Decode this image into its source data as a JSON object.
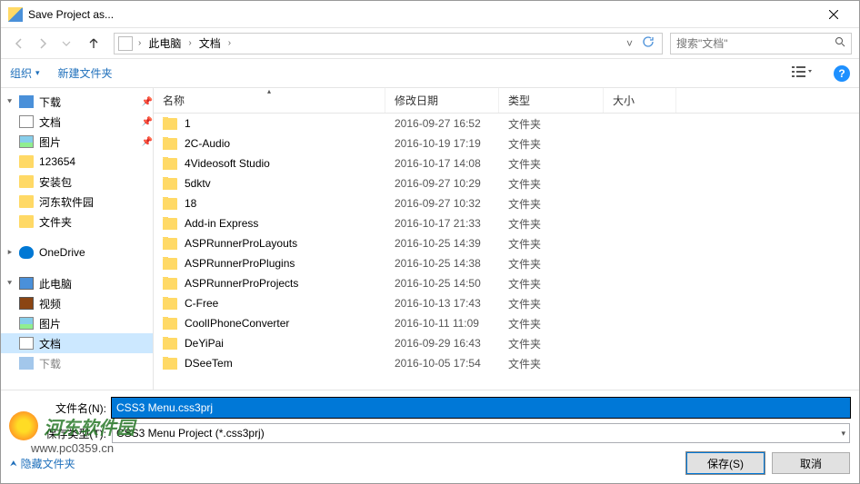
{
  "title": "Save Project as...",
  "breadcrumb": {
    "pc": "此电脑",
    "docs": "文档"
  },
  "search_placeholder": "搜索\"文档\"",
  "toolbar": {
    "organize": "组织",
    "newfolder": "新建文件夹"
  },
  "sidebar": {
    "downloads": "下载",
    "docs": "文档",
    "pics": "图片",
    "f123654": "123654",
    "install": "安装包",
    "hedong": "河东软件园",
    "folder": "文件夹",
    "onedrive": "OneDrive",
    "thispc": "此电脑",
    "video": "视频",
    "pics2": "图片",
    "docs2": "文档",
    "downloads2": "下载"
  },
  "columns": {
    "name": "名称",
    "date": "修改日期",
    "type": "类型",
    "size": "大小"
  },
  "files": [
    {
      "name": "1",
      "date": "2016-09-27 16:52",
      "type": "文件夹"
    },
    {
      "name": "2C-Audio",
      "date": "2016-10-19 17:19",
      "type": "文件夹"
    },
    {
      "name": "4Videosoft Studio",
      "date": "2016-10-17 14:08",
      "type": "文件夹"
    },
    {
      "name": "5dktv",
      "date": "2016-09-27 10:29",
      "type": "文件夹"
    },
    {
      "name": "18",
      "date": "2016-09-27 10:32",
      "type": "文件夹"
    },
    {
      "name": "Add-in Express",
      "date": "2016-10-17 21:33",
      "type": "文件夹"
    },
    {
      "name": "ASPRunnerProLayouts",
      "date": "2016-10-25 14:39",
      "type": "文件夹"
    },
    {
      "name": "ASPRunnerProPlugins",
      "date": "2016-10-25 14:38",
      "type": "文件夹"
    },
    {
      "name": "ASPRunnerProProjects",
      "date": "2016-10-25 14:50",
      "type": "文件夹"
    },
    {
      "name": "C-Free",
      "date": "2016-10-13 17:43",
      "type": "文件夹"
    },
    {
      "name": "CoolIPhoneConverter",
      "date": "2016-10-11 11:09",
      "type": "文件夹"
    },
    {
      "name": "DeYiPai",
      "date": "2016-09-29 16:43",
      "type": "文件夹"
    },
    {
      "name": "DSeeTem",
      "date": "2016-10-05 17:54",
      "type": "文件夹"
    }
  ],
  "labels": {
    "filename": "文件名(N):",
    "filetype": "保存类型(T):",
    "hidefolders": "隐藏文件夹",
    "save": "保存(S)",
    "cancel": "取消"
  },
  "filename_value": "CSS3 Menu.css3prj",
  "filetype_value": "CSS3 Menu Project (*.css3prj)",
  "watermark": {
    "text": "河东软件园",
    "url": "www.pc0359.cn"
  }
}
